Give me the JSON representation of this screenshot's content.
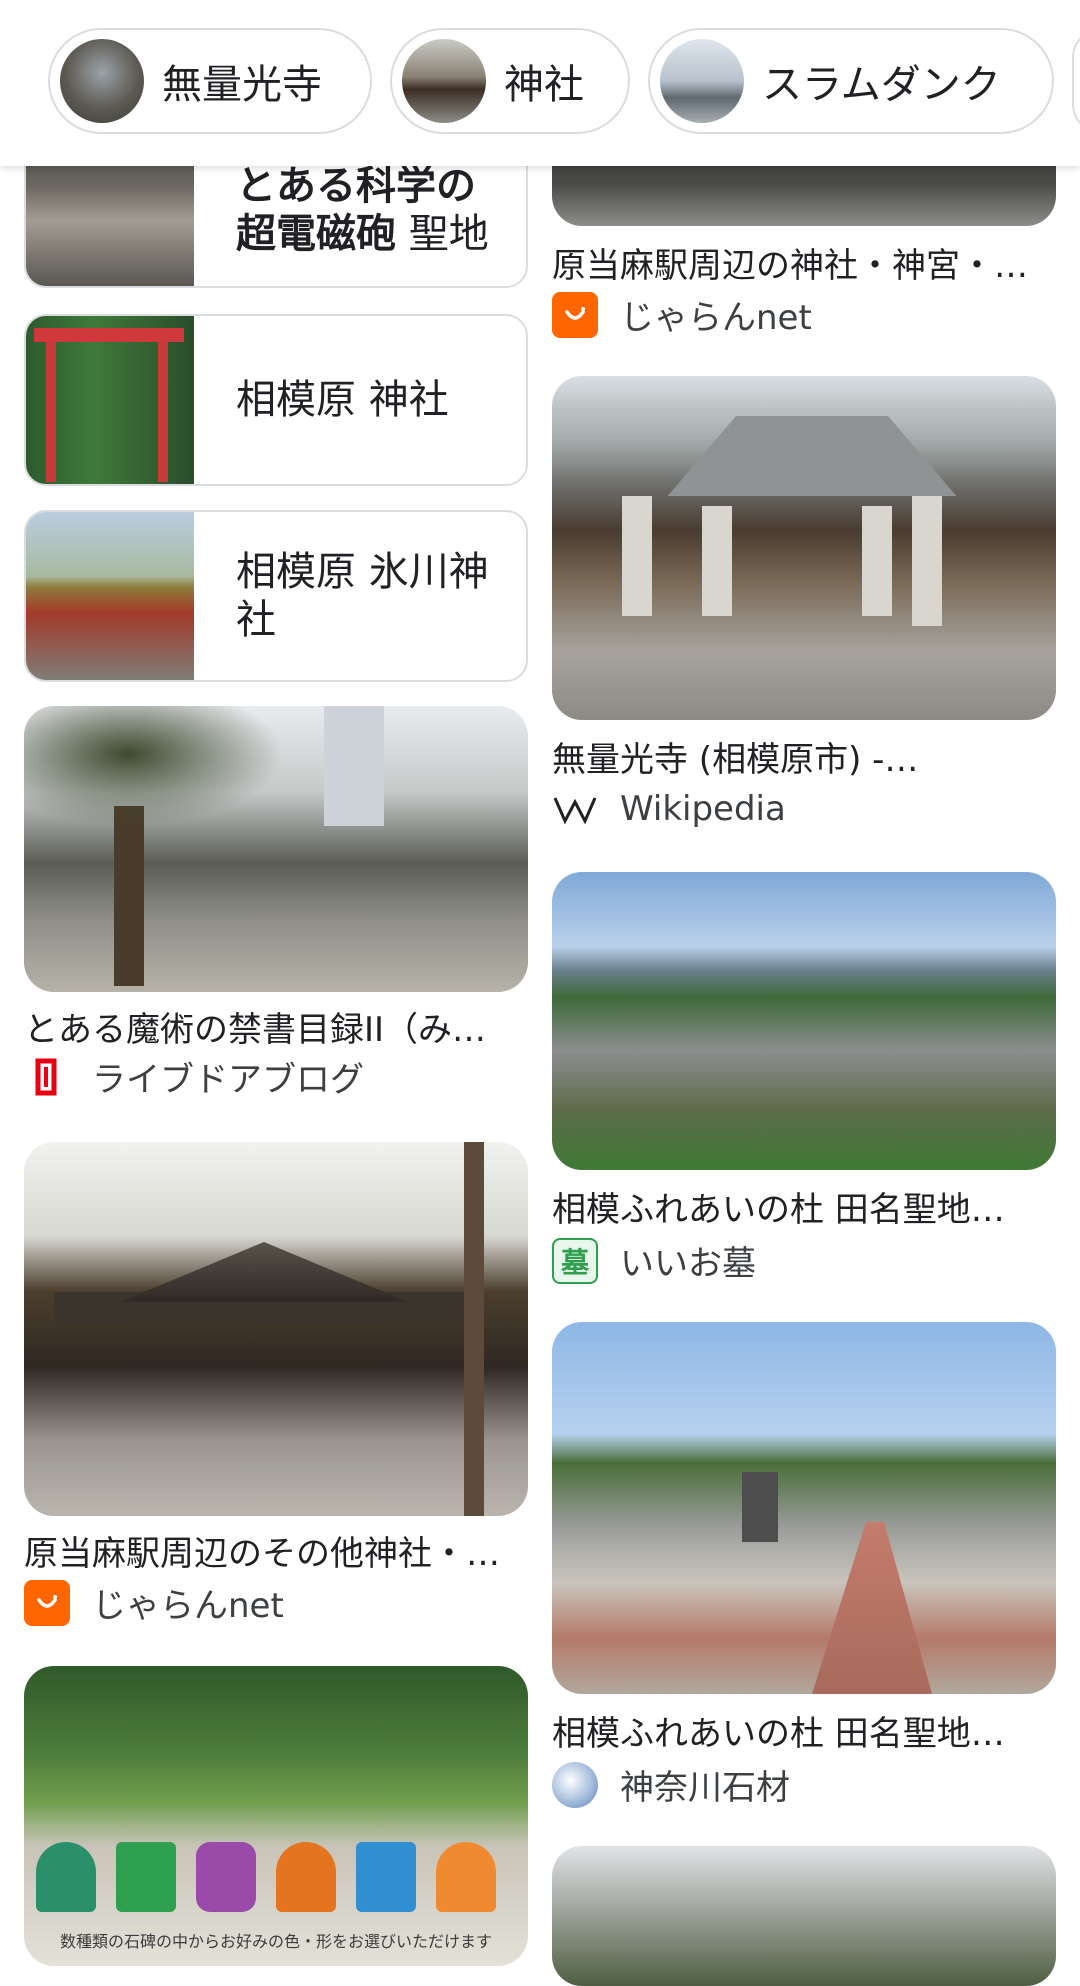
{
  "chips": [
    {
      "label": "無量光寺"
    },
    {
      "label": "神社"
    },
    {
      "label": "スラムダンク"
    }
  ],
  "related": [
    {
      "label_bold": "とある科学の超電磁砲",
      "label_rest": " 聖地"
    },
    {
      "label": "相模原 神社"
    },
    {
      "label": "相模原 氷川神社"
    }
  ],
  "results_left": [
    {
      "title": "とある魔術の禁書目録II（み…",
      "source": "ライブドアブログ",
      "icon": "livedoor-icon"
    },
    {
      "title": "原当麻駅周辺のその他神社・…",
      "source": "じゃらんnet",
      "icon": "jalan-icon"
    },
    {
      "overlay_text": "数種類の石碑の中からお好みの色・形をお選びいただけます"
    }
  ],
  "results_right": [
    {
      "title": "原当麻駅周辺の神社・神宮・…",
      "source": "じゃらんnet",
      "icon": "jalan-icon"
    },
    {
      "title": "無量光寺 (相模原市) -…",
      "source": "Wikipedia",
      "icon": "wikipedia-icon"
    },
    {
      "title": "相模ふれあいの杜 田名聖地…",
      "source": "いいお墓",
      "icon": "iiohaka-icon",
      "icon_glyph": "墓"
    },
    {
      "title": "相模ふれあいの杜 田名聖地…",
      "source": "神奈川石材",
      "icon": "globe-icon"
    }
  ],
  "colors": {
    "jalan": "#ff6600",
    "livedoor": "#e60012",
    "iiohaka": "#2e9e4f",
    "border": "#dadce0"
  }
}
